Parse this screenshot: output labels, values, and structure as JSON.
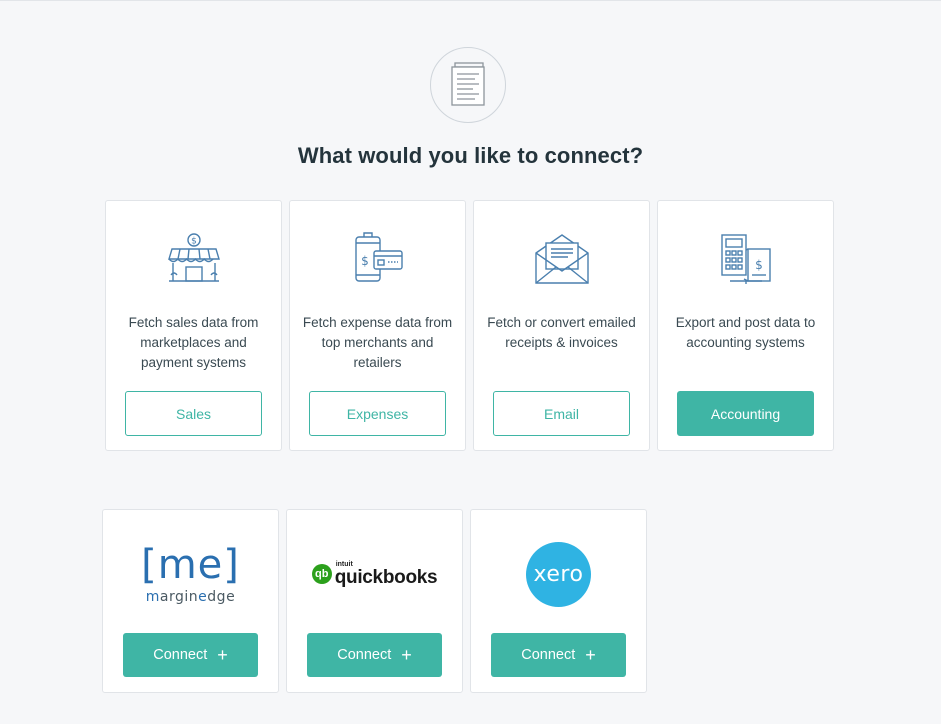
{
  "heading": "What would you like to connect?",
  "header_icon": "document-list-icon",
  "connection_types": [
    {
      "icon": "storefront-icon",
      "description": "Fetch sales data from marketplaces and payment systems",
      "button_label": "Sales",
      "selected": false
    },
    {
      "icon": "phone-card-icon",
      "description": "Fetch expense data from top merchants and retailers",
      "button_label": "Expenses",
      "selected": false
    },
    {
      "icon": "envelope-icon",
      "description": "Fetch or convert emailed receipts & invoices",
      "button_label": "Email",
      "selected": false
    },
    {
      "icon": "calculator-ledger-icon",
      "description": "Export and post data to accounting systems",
      "button_label": "Accounting",
      "selected": true
    }
  ],
  "integrations": [
    {
      "name": "marginedge",
      "logo_mark": "[me]",
      "logo_word_a": "m",
      "logo_word_b": "argin",
      "logo_word_c": "e",
      "logo_word_d": "dge",
      "button_label": "Connect",
      "button_icon": "+"
    },
    {
      "name": "quickbooks",
      "logo_badge": "qb",
      "logo_small": "intuit",
      "logo_word": "quickbooks",
      "button_label": "Connect",
      "button_icon": "+"
    },
    {
      "name": "xero",
      "logo_word": "xero",
      "button_label": "Connect",
      "button_icon": "+"
    }
  ],
  "colors": {
    "accent": "#3fb5a5",
    "icon_stroke": "#4a7fae",
    "background": "#f6f7f9",
    "xero": "#2fb3e3",
    "quickbooks": "#2ca01c",
    "marginedge": "#2a6fb0"
  }
}
